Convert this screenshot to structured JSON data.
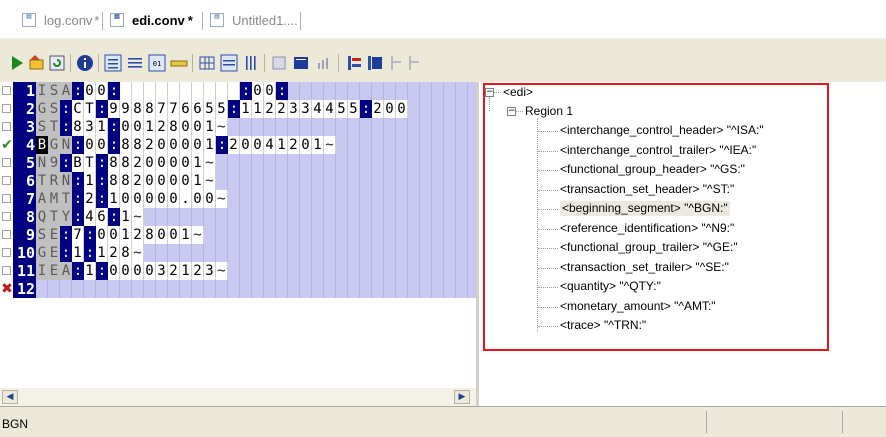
{
  "tabs": [
    {
      "label": "log.conv",
      "modified": "*",
      "active": false,
      "icon": "xml-file-icon"
    },
    {
      "label": "edi.conv",
      "modified": "*",
      "active": true,
      "icon": "xml-file-icon"
    },
    {
      "label": "Untitled1....",
      "modified": "",
      "active": false,
      "icon": "xml-file-icon"
    }
  ],
  "toolbar": {
    "buttons": [
      "run-icon",
      "open-icon",
      "refresh-icon",
      "info-icon",
      "view-list-icon",
      "align-icon",
      "binary-view-icon",
      "ruler-icon",
      "grid-columns-icon",
      "rows-icon",
      "column-bars-icon",
      "panel-icon",
      "table-icon",
      "chart-icon",
      "tree-add-icon",
      "tree-table-icon",
      "tree-a-icon",
      "tree-b-icon"
    ]
  },
  "grid": {
    "rows": [
      {
        "num": "1",
        "mark": "",
        "segment": "ISA",
        "values": [
          "00",
          "",
          "00"
        ],
        "terminator": ""
      },
      {
        "num": "2",
        "mark": "",
        "segment": "GS",
        "values": [
          "CT",
          "9988776655",
          "1122334455",
          "200"
        ],
        "terminator": ""
      },
      {
        "num": "3",
        "mark": "",
        "segment": "ST",
        "values": [
          "831",
          "00128001"
        ],
        "terminator": "~"
      },
      {
        "num": "4",
        "mark": "check",
        "segment": "BGN",
        "values": [
          "00",
          "88200001",
          "20041201"
        ],
        "terminator": "~"
      },
      {
        "num": "5",
        "mark": "",
        "segment": "N9",
        "values": [
          "BT",
          "88200001"
        ],
        "terminator": "~"
      },
      {
        "num": "6",
        "mark": "",
        "segment": "TRN",
        "values": [
          "1",
          "88200001"
        ],
        "terminator": "~"
      },
      {
        "num": "7",
        "mark": "",
        "segment": "AMT",
        "values": [
          "2",
          "100000.00"
        ],
        "terminator": "~"
      },
      {
        "num": "8",
        "mark": "",
        "segment": "QTY",
        "values": [
          "46",
          "1"
        ],
        "terminator": "~"
      },
      {
        "num": "9",
        "mark": "",
        "segment": "SE",
        "values": [
          "7",
          "00128001"
        ],
        "terminator": "~"
      },
      {
        "num": "10",
        "mark": "",
        "segment": "GE",
        "values": [
          "1",
          "128"
        ],
        "terminator": "~"
      },
      {
        "num": "11",
        "mark": "",
        "segment": "IEA",
        "values": [
          "1",
          "000032123"
        ],
        "terminator": "~"
      },
      {
        "num": "12",
        "mark": "cross",
        "segment": "",
        "values": [],
        "terminator": ""
      }
    ]
  },
  "tree": {
    "root": "<edi>",
    "region": "Region 1",
    "items": [
      "<interchange_control_header> \"^ISA:\"",
      "<interchange_control_trailer> \"^IEA:\"",
      "<functional_group_header> \"^GS:\"",
      "<transaction_set_header> \"^ST:\"",
      "<beginning_segment> \"^BGN:\"",
      "<reference_identification> \"^N9:\"",
      "<functional_group_trailer> \"^GE:\"",
      "<transaction_set_trailer> \"^SE:\"",
      "<quantity> \"^QTY:\"",
      "<monetary_amount> \"^AMT:\"",
      "<trace> \"^TRN:\""
    ],
    "selected_index": 4
  },
  "status": {
    "text": "BGN"
  },
  "colors": {
    "row_number_bg": "#000080",
    "highlight_box": "#e2161d",
    "segment_bg": "#c0c0c0",
    "check": "#2e8b2e",
    "cross": "#c01818"
  }
}
